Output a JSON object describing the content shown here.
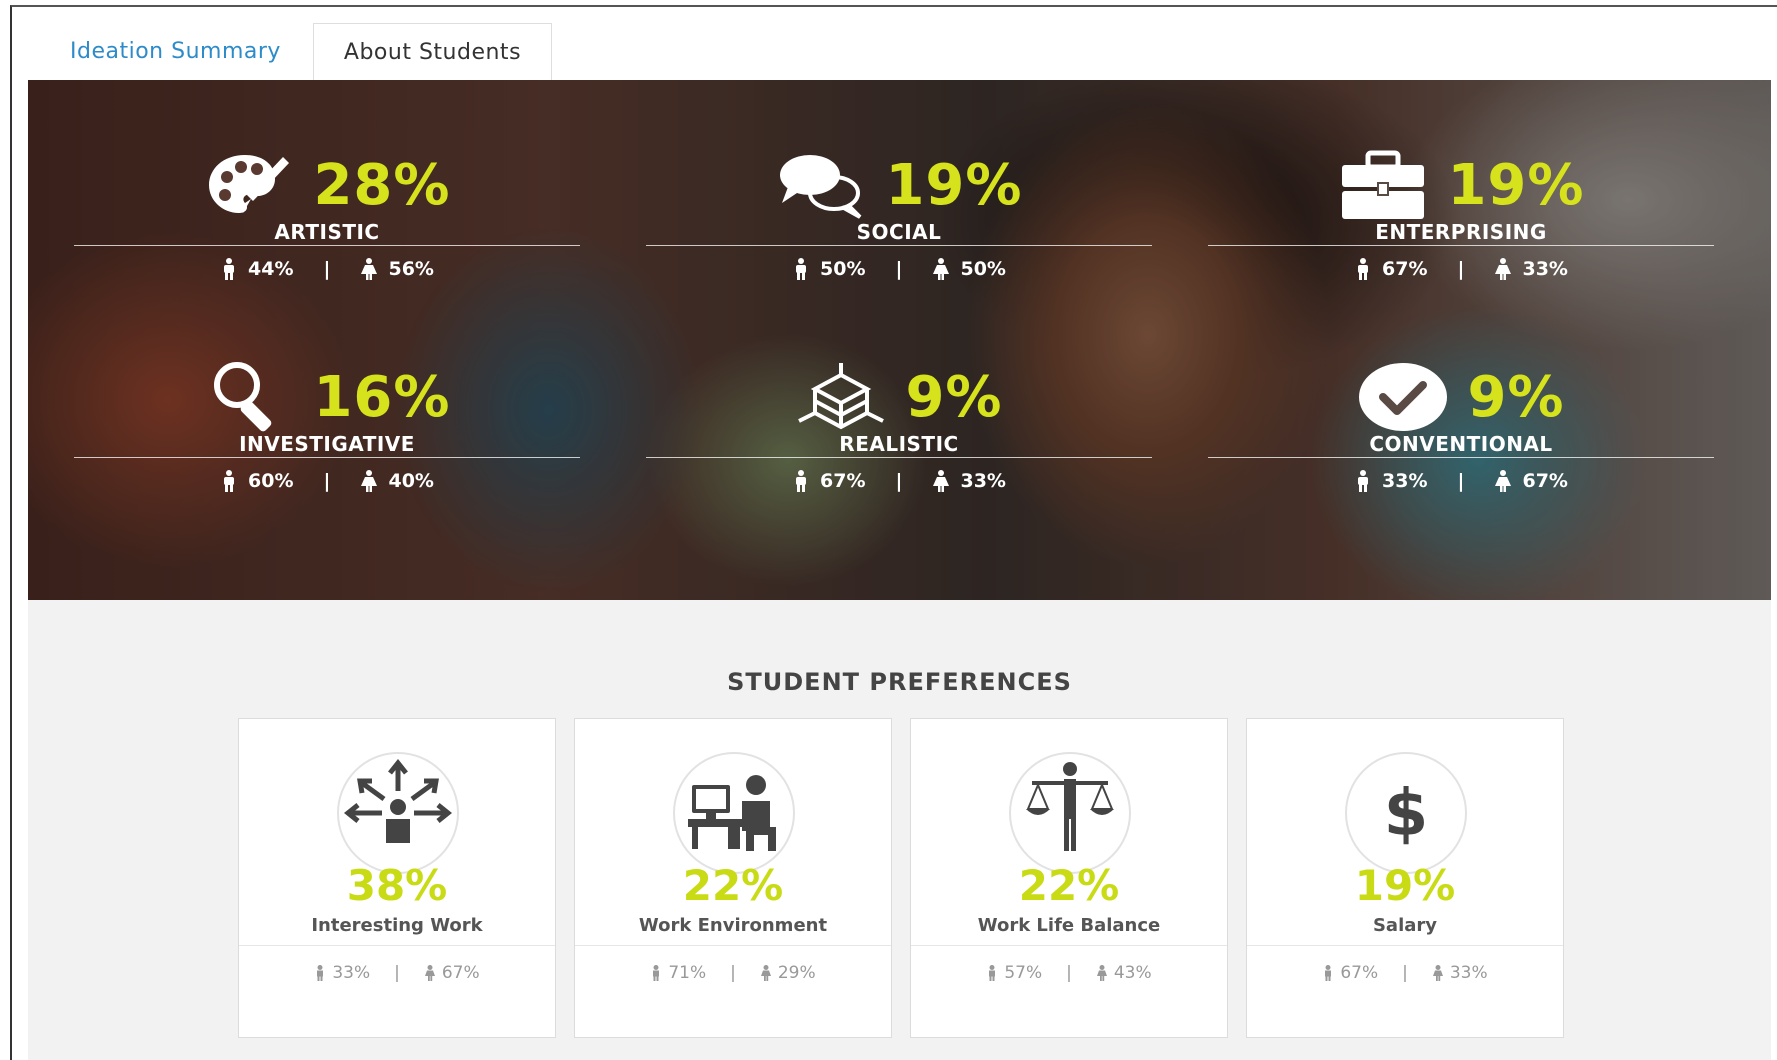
{
  "tabs": [
    {
      "label": "Ideation Summary",
      "active": false
    },
    {
      "label": "About Students",
      "active": true
    }
  ],
  "colors": {
    "accent": "#d6e21b",
    "tab_link": "#2e8bc9"
  },
  "stats": [
    {
      "icon": "palette-icon",
      "percent": "28%",
      "label": "ARTISTIC",
      "male": "44%",
      "female": "56%"
    },
    {
      "icon": "speech-bubbles-icon",
      "percent": "19%",
      "label": "SOCIAL",
      "male": "50%",
      "female": "50%"
    },
    {
      "icon": "briefcase-icon",
      "percent": "19%",
      "label": "ENTERPRISING",
      "male": "67%",
      "female": "33%"
    },
    {
      "icon": "magnifier-icon",
      "percent": "16%",
      "label": "INVESTIGATIVE",
      "male": "60%",
      "female": "40%"
    },
    {
      "icon": "structure-icon",
      "percent": "9%",
      "label": "REALISTIC",
      "male": "67%",
      "female": "33%"
    },
    {
      "icon": "checkmark-icon",
      "percent": "9%",
      "label": "CONVENTIONAL",
      "male": "33%",
      "female": "67%"
    }
  ],
  "separator": "|",
  "preferences": {
    "title": "STUDENT PREFERENCES",
    "cards": [
      {
        "icon": "directions-person-icon",
        "percent": "38%",
        "label": "Interesting Work",
        "male": "33%",
        "female": "67%"
      },
      {
        "icon": "desk-worker-icon",
        "percent": "22%",
        "label": "Work Environment",
        "male": "71%",
        "female": "29%"
      },
      {
        "icon": "scales-person-icon",
        "percent": "22%",
        "label": "Work Life Balance",
        "male": "57%",
        "female": "43%"
      },
      {
        "icon": "dollar-icon",
        "percent": "19%",
        "label": "Salary",
        "male": "67%",
        "female": "33%"
      }
    ]
  }
}
